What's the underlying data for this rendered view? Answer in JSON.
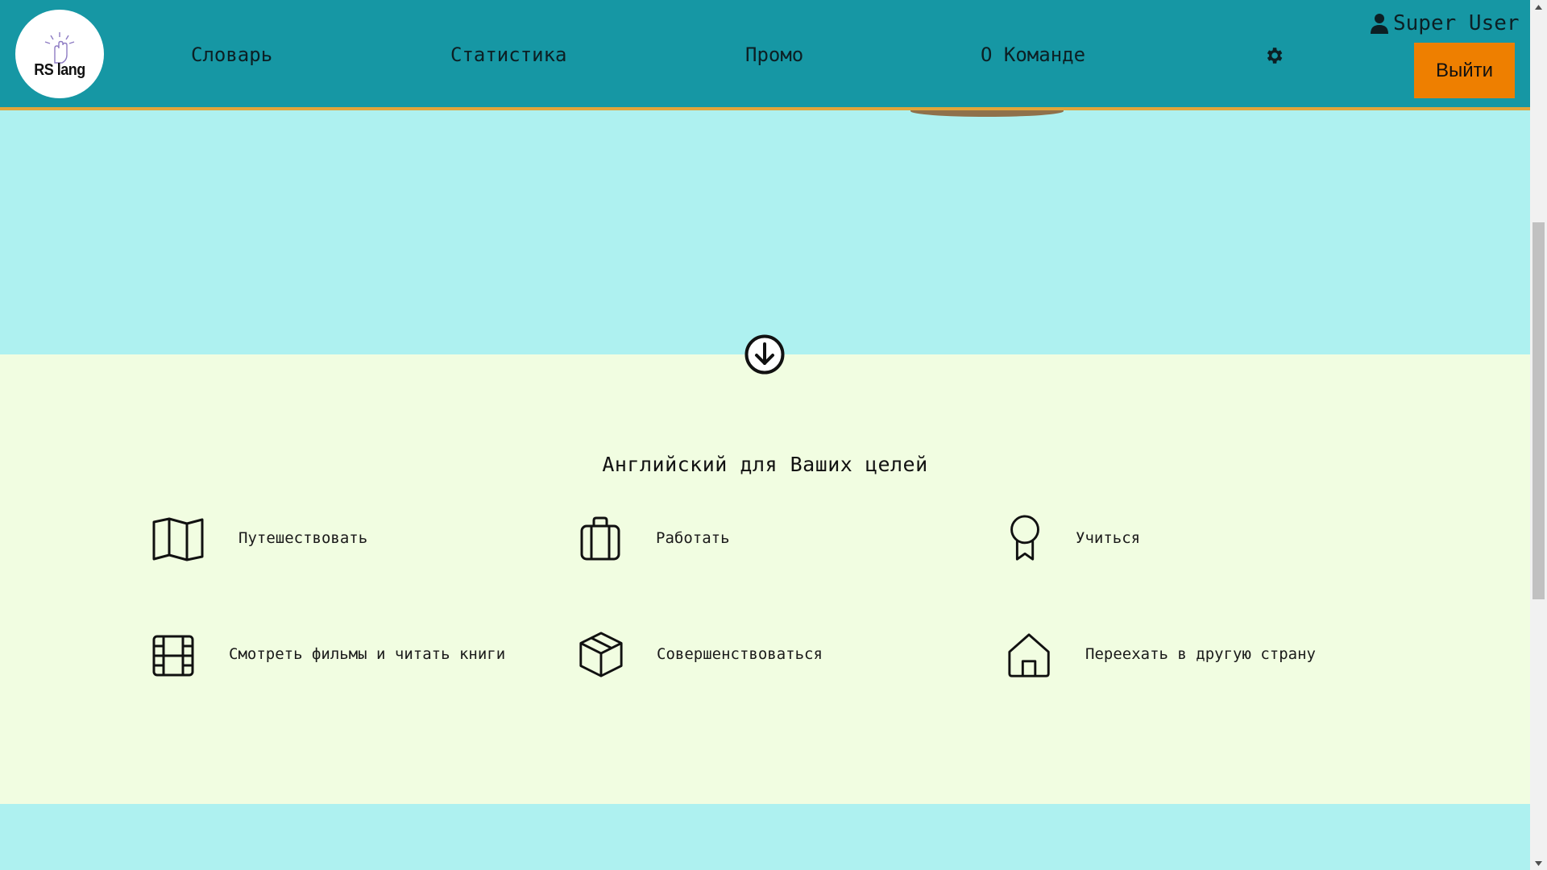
{
  "header": {
    "logo_text": "RS lang",
    "nav": [
      {
        "label": "Словарь"
      },
      {
        "label": "Статистика"
      },
      {
        "label": "Промо"
      },
      {
        "label": "О Команде"
      }
    ],
    "settings_icon": "gear-icon",
    "user_name": "Super User",
    "user_icon": "user-icon",
    "logout_label": "Выйти"
  },
  "goals": {
    "title": "Английский для Ваших целей",
    "items": [
      {
        "label": "Путешествовать",
        "icon": "map-icon"
      },
      {
        "label": "Работать",
        "icon": "briefcase-icon"
      },
      {
        "label": "Учиться",
        "icon": "award-icon"
      },
      {
        "label": "Смотреть фильмы и читать книги",
        "icon": "film-icon"
      },
      {
        "label": "Совершенствоваться",
        "icon": "box-icon"
      },
      {
        "label": "Переехать в другую страну",
        "icon": "home-icon"
      }
    ]
  },
  "colors": {
    "header_bg": "#1697a4",
    "header_border": "#e2a53a",
    "hero_bg": "#aef1f0",
    "goals_bg": "#f1fde1",
    "logout_bg": "#ee7f00"
  }
}
